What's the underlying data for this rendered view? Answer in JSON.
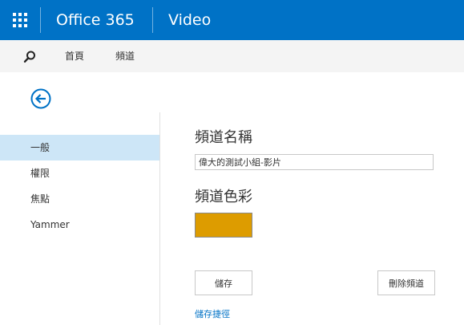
{
  "header": {
    "app_name": "Office 365",
    "product_name": "Video",
    "background_color": "#0072c6",
    "app_launcher_icon": "waffle-icon"
  },
  "nav": {
    "search_icon": "search-icon",
    "items": [
      {
        "label": "首頁"
      },
      {
        "label": "頻道"
      }
    ]
  },
  "back_icon": "back-arrow-icon",
  "sidebar": {
    "items": [
      {
        "label": "一般",
        "selected": true
      },
      {
        "label": "權限",
        "selected": false
      },
      {
        "label": "焦點",
        "selected": false
      },
      {
        "label": "Yammer",
        "selected": false
      }
    ]
  },
  "main": {
    "channel_name_label": "頻道名稱",
    "channel_name_value": "偉大的測試小組-影片",
    "channel_color_label": "頻道色彩",
    "channel_color": "#dd9c00",
    "save_label": "儲存",
    "delete_label": "刪除頻道",
    "save_shortcut_label": "儲存捷徑"
  }
}
